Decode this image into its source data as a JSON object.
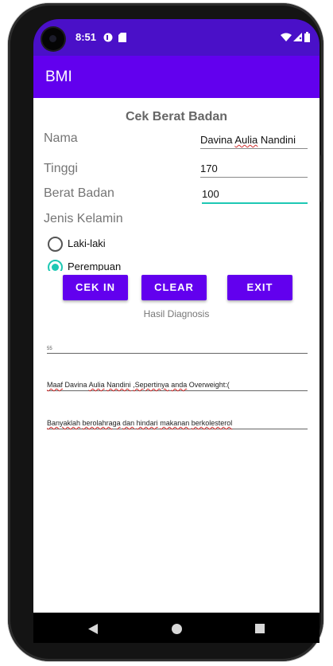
{
  "status_bar": {
    "time": "8:51",
    "icons": [
      "lock-badge-icon",
      "sd-card-icon",
      "wifi-icon",
      "signal-icon",
      "battery-icon"
    ]
  },
  "app_bar": {
    "title": "BMI"
  },
  "form": {
    "heading": "Cek Berat Badan",
    "nama_label": "Nama",
    "nama_value": "Davina Aulia Nandini",
    "tinggi_label": "Tinggi",
    "tinggi_value": "170",
    "berat_label": "Berat Badan",
    "berat_value": "100",
    "jenis_label": "Jenis Kelamin",
    "options": [
      {
        "label": "Laki-laki",
        "selected": false
      },
      {
        "label": "Perempuan",
        "selected": true
      }
    ]
  },
  "buttons": {
    "cek_in": "CEK IN",
    "clear": "CLEAR",
    "exit": "EXIT"
  },
  "result": {
    "caption": "Hasil Diagnosis",
    "bmi_value": "55",
    "diagnosis_parts": [
      "Maaf",
      "Davina",
      "Aulia",
      "Nandini",
      ",Sepertinya",
      "anda",
      "Overweight:("
    ],
    "advice_parts": [
      "Banyaklah",
      "berolahraga",
      "dan",
      "hindari",
      "makanan",
      "berkolesterol"
    ]
  },
  "colors": {
    "status_bar": "#4a10c8",
    "primary": "#6200ee",
    "accent": "#1ec8b4"
  },
  "nav_icons": [
    "back-icon",
    "home-icon",
    "recents-icon"
  ]
}
